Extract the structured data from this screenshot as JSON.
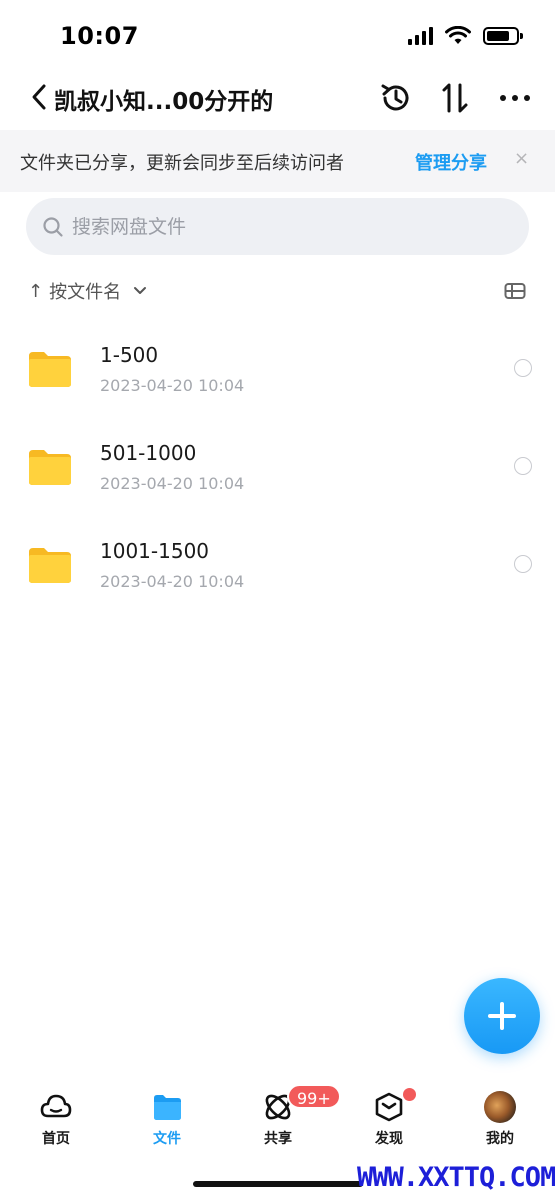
{
  "status_bar": {
    "time": "10:07"
  },
  "nav": {
    "title": "凯叔小知...00分开的"
  },
  "share_banner": {
    "text": "文件夹已分享，更新会同步至后续访问者",
    "action": "管理分享",
    "close": "×"
  },
  "search": {
    "placeholder": "搜索网盘文件"
  },
  "sort": {
    "label": "按文件名",
    "arrow": "↑"
  },
  "files": [
    {
      "name": "1-500",
      "date": "2023-04-20 10:04"
    },
    {
      "name": "501-1000",
      "date": "2023-04-20 10:04"
    },
    {
      "name": "1001-1500",
      "date": "2023-04-20 10:04"
    }
  ],
  "tabs": [
    {
      "label": "首页",
      "icon": "cloud-icon"
    },
    {
      "label": "文件",
      "icon": "folder-icon"
    },
    {
      "label": "共享",
      "icon": "orbit-icon"
    },
    {
      "label": "发现",
      "icon": "box-icon"
    },
    {
      "label": "我的",
      "icon": "avatar"
    }
  ],
  "share_badge": "99+",
  "watermark": "WWW.XXTTQ.COM",
  "colors": {
    "accent": "#1c9cf2",
    "folder": "#ffc93a",
    "badge": "#f25a5a"
  }
}
